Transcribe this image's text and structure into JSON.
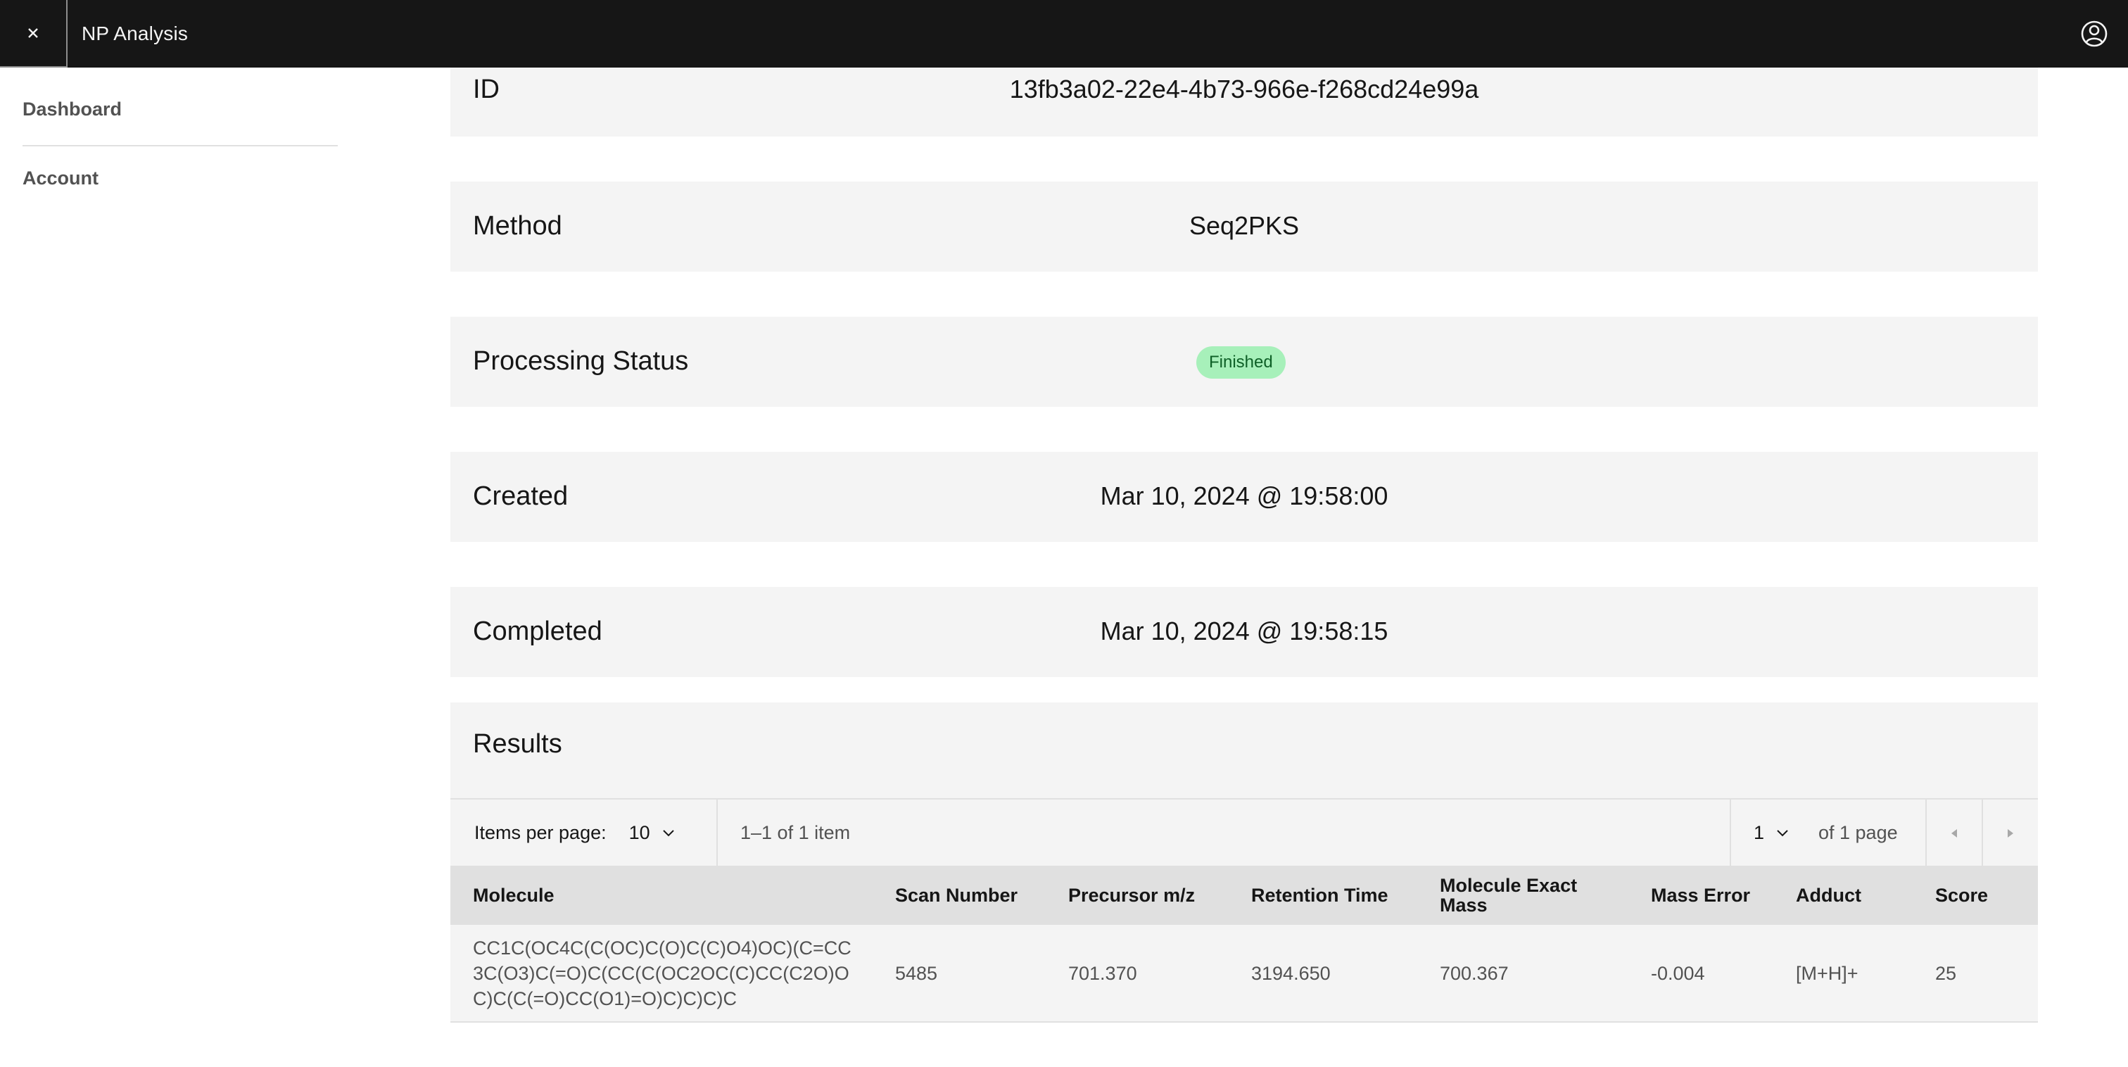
{
  "header": {
    "app_name": "NP Analysis",
    "menu_icon": "close-icon",
    "user_icon": "user-avatar-icon"
  },
  "sidebar": {
    "items": [
      {
        "label": "Dashboard"
      },
      {
        "label": "Account"
      }
    ]
  },
  "details": {
    "id": {
      "label": "ID",
      "value": "13fb3a02-22e4-4b73-966e-f268cd24e99a"
    },
    "method": {
      "label": "Method",
      "value": "Seq2PKS"
    },
    "status": {
      "label": "Processing Status",
      "value": "Finished",
      "color": "#a7f0ba"
    },
    "created": {
      "label": "Created",
      "value": "Mar 10, 2024 @ 19:58:00"
    },
    "completed": {
      "label": "Completed",
      "value": "Mar 10, 2024 @ 19:58:15"
    }
  },
  "results": {
    "title": "Results",
    "pagination": {
      "items_per_page_label": "Items per page:",
      "items_per_page": "10",
      "range": "1–1 of 1 item",
      "page": "1",
      "of_pages": "of 1 page"
    },
    "columns": [
      "Molecule",
      "Scan Number",
      "Precursor m/z",
      "Retention Time",
      "Molecule Exact Mass",
      "Mass Error",
      "Adduct",
      "Score"
    ],
    "rows": [
      {
        "molecule": "CC1C(OC4C(C(OC)C(O)C(C)O4)OC)(C=CC3C(O3)C(=O)C(CC(C(OC2OC(C)CC(C2O)OC)C(C(=O)CC(O1)=O)C)C)C)C",
        "scan_number": "5485",
        "precursor_mz": "701.370",
        "retention_time": "3194.650",
        "exact_mass": "700.367",
        "mass_error": "-0.004",
        "adduct": "[M+H]+",
        "score": "25"
      }
    ]
  }
}
